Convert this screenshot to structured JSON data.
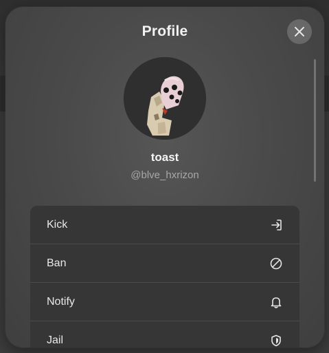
{
  "modal": {
    "title": "Profile",
    "close_icon": "close-icon"
  },
  "profile": {
    "display_name": "toast",
    "username": "@blve_hxrizon",
    "avatar_icon": "avatar-image"
  },
  "actions": [
    {
      "label": "Kick",
      "icon": "exit-icon"
    },
    {
      "label": "Ban",
      "icon": "ban-icon"
    },
    {
      "label": "Notify",
      "icon": "bell-icon"
    },
    {
      "label": "Jail",
      "icon": "shield-icon"
    }
  ],
  "colors": {
    "modal_bg": "#4a4a4a",
    "list_bg": "#363636",
    "text": "#e9e9e9",
    "muted": "#a8a8a8"
  }
}
